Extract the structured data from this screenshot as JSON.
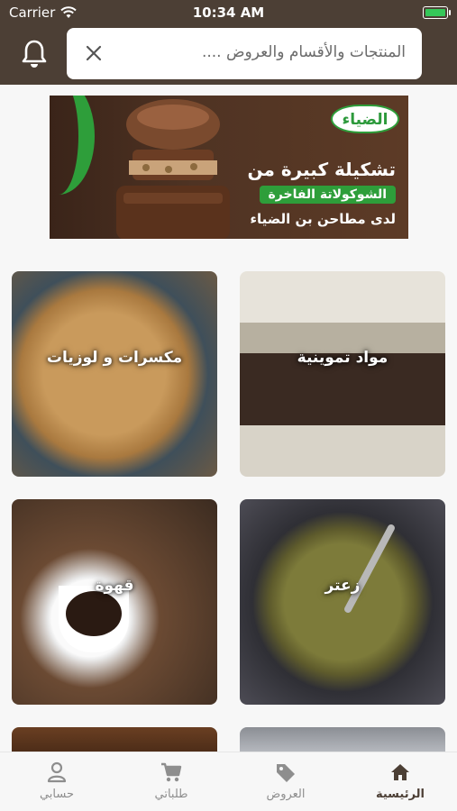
{
  "status_bar": {
    "carrier": "Carrier",
    "time": "10:34 AM"
  },
  "search": {
    "placeholder": "المنتجات والأقسام والعروض ...."
  },
  "banner": {
    "brand": "الضياء",
    "line1": "تشكيلة كبيرة من",
    "line2": "الشوكولاتة الفاخرة",
    "line3": "لدى مطاحن بن الضياء"
  },
  "categories": [
    {
      "label": "مكسرات و لوزيات"
    },
    {
      "label": "مواد تموينية"
    },
    {
      "label": "قهوة"
    },
    {
      "label": "زعتر"
    }
  ],
  "tabbar": {
    "items": [
      {
        "label": "الرئيسية",
        "icon": "home-icon",
        "active": true
      },
      {
        "label": "العروض",
        "icon": "tag-icon"
      },
      {
        "label": "طلباتي",
        "icon": "cart-icon"
      },
      {
        "label": "حسابي",
        "icon": "user-icon"
      }
    ]
  },
  "colors": {
    "header": "#4c3f35",
    "accent_green": "#2e9e3a",
    "active_tab": "#4c3f35",
    "inactive_tab": "#8e8e8e"
  }
}
